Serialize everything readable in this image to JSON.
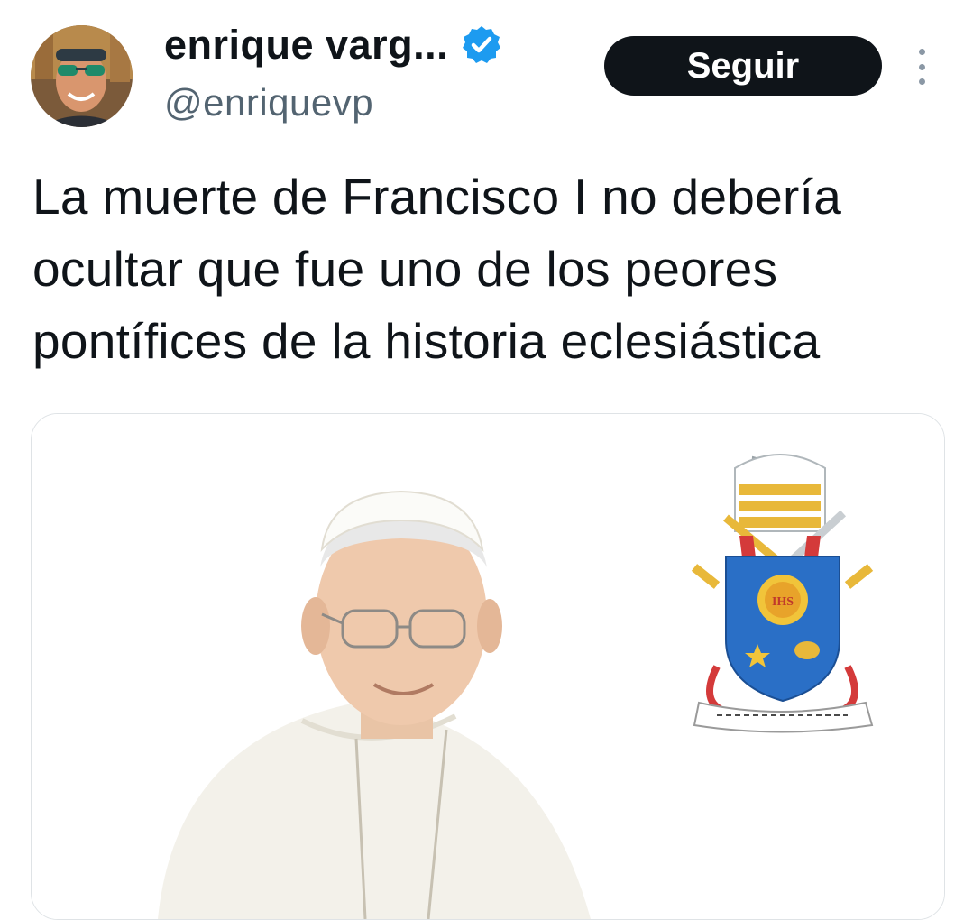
{
  "author": {
    "display_name": "enrique varg...",
    "handle": "@enriquevp",
    "verified": true,
    "avatar_icon": "user-avatar-photo"
  },
  "actions": {
    "follow_label": "Seguir",
    "more_icon": "more-options-icon"
  },
  "tweet": {
    "text": "La muerte de Francisco I no debería ocultar que fue uno de los peores pontífices de la historia eclesiástica"
  },
  "media": {
    "coat_of_arms_monogram": "IHS"
  },
  "colors": {
    "follow_button_bg": "#0f1419",
    "verified_badge": "#1d9bf0",
    "handle_text": "#536471",
    "shield_blue": "#2a6fc6",
    "gold": "#e8b83a"
  }
}
